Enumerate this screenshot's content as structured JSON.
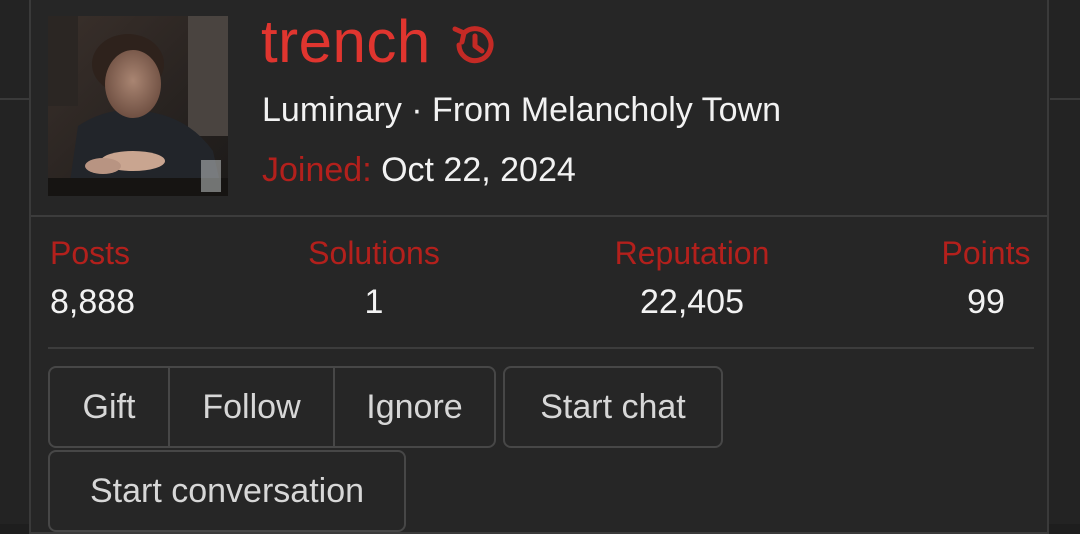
{
  "profile": {
    "username": "trench",
    "title_line": "Luminary · From Melancholy Town",
    "joined_label": "Joined:",
    "joined_value": "Oct 22, 2024",
    "username_color": "#e0352f",
    "label_color": "#b3201c",
    "history_icon": "history-icon"
  },
  "stats": [
    {
      "label": "Posts",
      "value": "8,888"
    },
    {
      "label": "Solutions",
      "value": "1"
    },
    {
      "label": "Reputation",
      "value": "22,405"
    },
    {
      "label": "Points",
      "value": "99"
    }
  ],
  "actions": {
    "gift": "Gift",
    "follow": "Follow",
    "ignore": "Ignore",
    "start_chat": "Start chat",
    "start_conversation": "Start conversation"
  }
}
